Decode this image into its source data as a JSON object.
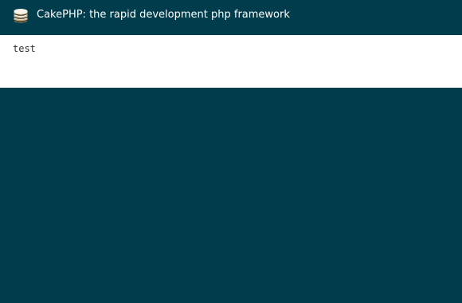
{
  "header": {
    "logo_icon": "cakephp-stacked-cake-icon",
    "title": "CakePHP: the rapid development php framework"
  },
  "content": {
    "text": "test"
  },
  "colors": {
    "background": "#003d4c",
    "content_background": "#ffffff",
    "header_text": "#ffffff"
  }
}
